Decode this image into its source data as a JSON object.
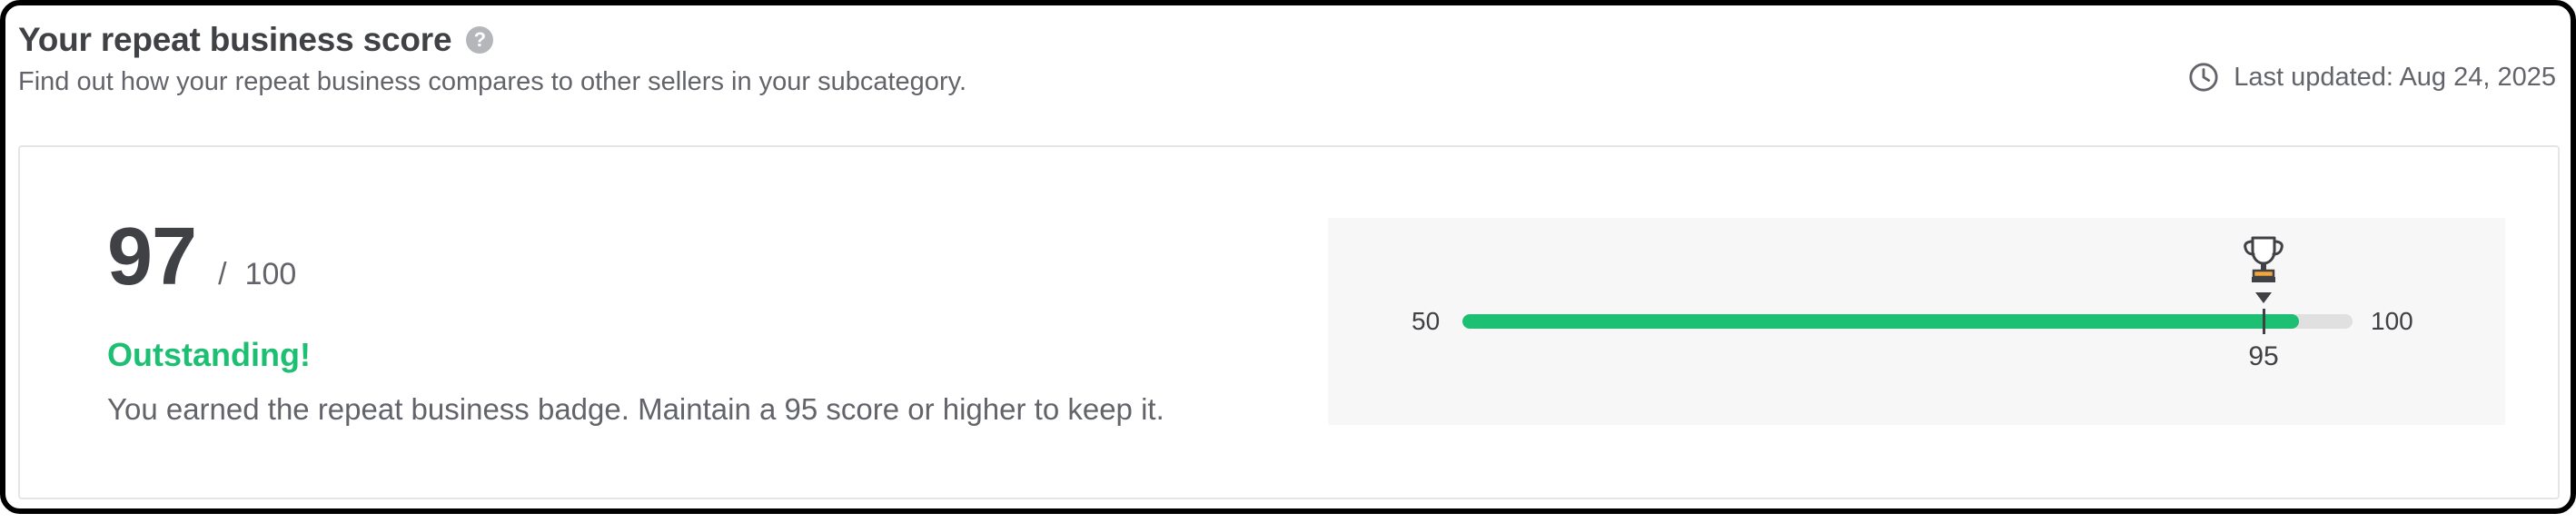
{
  "header": {
    "title": "Your repeat business score",
    "help_icon": "question-mark-icon",
    "help_glyph": "?",
    "subtitle": "Find out how your repeat business compares to other sellers in your subcategory.",
    "clock_icon": "clock-icon",
    "last_updated": "Last updated: Aug 24, 2025"
  },
  "score": {
    "value": "97",
    "separator": "/",
    "max": "100",
    "status": "Outstanding!",
    "description": "You earned the repeat business badge. Maintain a 95 score or higher to keep it."
  },
  "gauge": {
    "min_label": "50",
    "max_label": "100",
    "min": 50,
    "max": 100,
    "current": 97,
    "threshold": 95,
    "threshold_label": "95",
    "threshold_icon": "trophy-icon",
    "fill_color": "#1dbf73",
    "track_color": "#e0e0e0"
  },
  "colors": {
    "accent_green": "#1dbf73",
    "text_dark": "#404145",
    "text_muted": "#62646a",
    "trophy_gold": "#f2a63b"
  }
}
